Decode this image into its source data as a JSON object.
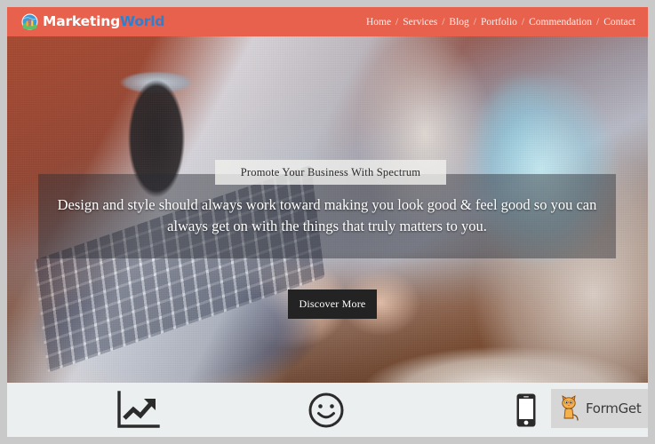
{
  "header": {
    "brand": {
      "icon": "globe-chart-logo-icon",
      "text_primary": "Marketing",
      "text_secondary": "World",
      "color_primary": "#ffffff",
      "color_secondary": "#2f7fd0"
    },
    "background_color": "#e8614d",
    "nav": {
      "separator": "/",
      "items": [
        {
          "label": "Home"
        },
        {
          "label": "Services"
        },
        {
          "label": "Blog"
        },
        {
          "label": "Portfolio"
        },
        {
          "label": "Commendation"
        },
        {
          "label": "Contact"
        }
      ]
    }
  },
  "hero": {
    "caption": "Promote Your Business With Spectrum",
    "lead": "Design and style should always work toward making you look good & feel good so you can always get on with the things that truly matters to you.",
    "cta_label": "Discover More",
    "cta_background": "#232323",
    "overlay_color": "rgba(42,44,52,0.45)",
    "caption_background": "rgba(240,240,238,0.80)"
  },
  "features": {
    "background_color": "#eceff0",
    "items": [
      {
        "icon": "chart-trending-up-icon"
      },
      {
        "icon": "smiley-face-icon"
      },
      {
        "icon": "mobile-phone-icon"
      }
    ]
  },
  "watermark": {
    "icon": "formget-cat-mascot-icon",
    "label": "FormGet",
    "background_color": "#d6d6d6"
  },
  "page": {
    "background_color": "#c9c9c9"
  }
}
